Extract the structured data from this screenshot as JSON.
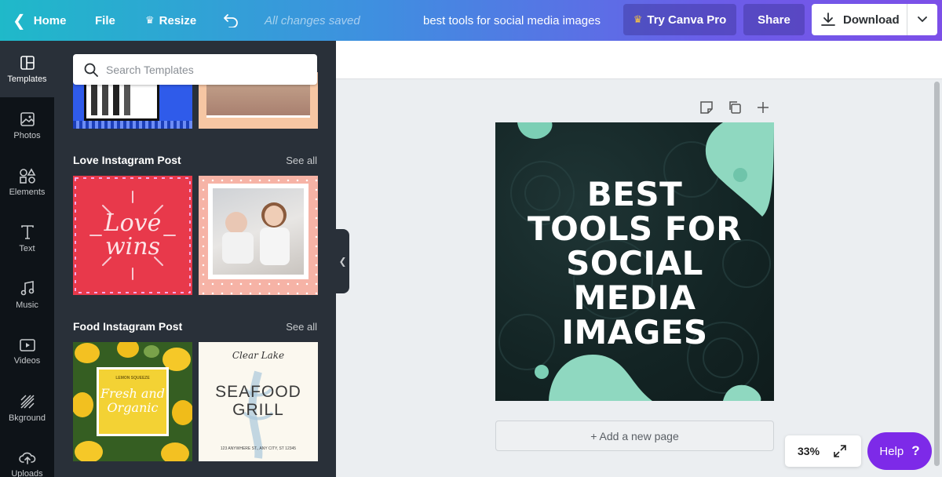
{
  "topbar": {
    "home_label": "Home",
    "file_label": "File",
    "resize_label": "Resize",
    "saved_status": "All changes saved",
    "document_title": "best tools for social media images",
    "pro_label": "Try Canva Pro",
    "share_label": "Share",
    "download_label": "Download"
  },
  "rail": {
    "items": [
      {
        "label": "Templates",
        "icon": "templates-icon"
      },
      {
        "label": "Photos",
        "icon": "photos-icon"
      },
      {
        "label": "Elements",
        "icon": "elements-icon"
      },
      {
        "label": "Text",
        "icon": "text-icon"
      },
      {
        "label": "Music",
        "icon": "music-icon"
      },
      {
        "label": "Videos",
        "icon": "videos-icon"
      },
      {
        "label": "Bkground",
        "icon": "background-icon"
      },
      {
        "label": "Uploads",
        "icon": "uploads-icon"
      }
    ]
  },
  "panel": {
    "search_placeholder": "Search Templates",
    "sections": [
      {
        "title": "Love Instagram Post",
        "see_all": "See all"
      },
      {
        "title": "Food Instagram Post",
        "see_all": "See all"
      }
    ],
    "thumbs": {
      "love_text_1": "Love",
      "love_text_2": "wins",
      "lemon_small": "LEMON SQUEEZE",
      "lemon_line1": "Fresh and",
      "lemon_line2": "Organic",
      "seafood_script": "Clear Lake",
      "seafood_title_1": "SEAFOOD",
      "seafood_title_2": "GRILL",
      "seafood_address": "123 ANYWHERE ST., ANY CITY, ST 12345"
    }
  },
  "canvas": {
    "design_lines": [
      "BEST",
      "TOOLS FOR",
      "SOCIAL",
      "MEDIA",
      "IMAGES"
    ],
    "add_page_label": "+ Add a new page",
    "zoom_level": "33%",
    "help_label": "Help"
  },
  "colors": {
    "accent": "#7d2ae8",
    "panel_bg": "#293039",
    "rail_bg": "#0e1318",
    "mint": "#8fd8c0"
  }
}
